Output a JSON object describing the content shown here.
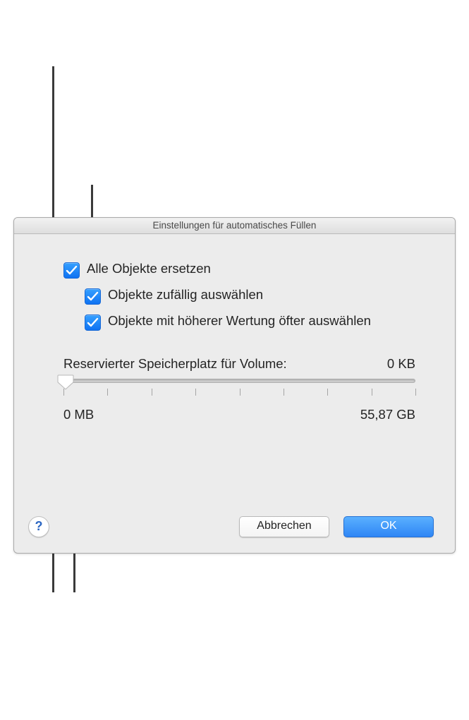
{
  "dialog": {
    "title": "Einstellungen für automatisches Füllen",
    "checkboxes": {
      "replace_all": {
        "label": "Alle Objekte ersetzen",
        "checked": true
      },
      "random_select": {
        "label": "Objekte zufällig auswählen",
        "checked": true
      },
      "higher_rating": {
        "label": "Objekte mit höherer Wertung öfter auswählen",
        "checked": true
      }
    },
    "slider": {
      "label": "Reservierter Speicherplatz für Volume:",
      "value_text": "0 KB",
      "min_label": "0 MB",
      "max_label": "55,87 GB"
    },
    "buttons": {
      "help": "?",
      "cancel": "Abbrechen",
      "ok": "OK"
    }
  }
}
